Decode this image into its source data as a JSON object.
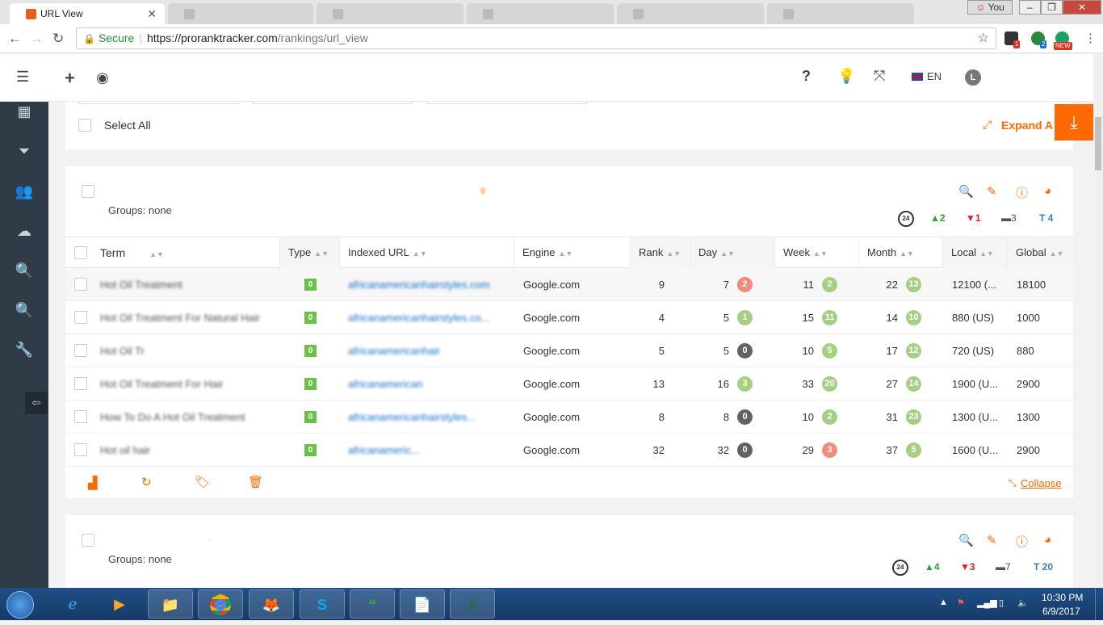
{
  "browser": {
    "tabs": [
      {
        "title": "URL View",
        "active": true
      },
      {
        "title": "",
        "active": false
      },
      {
        "title": "",
        "active": false
      },
      {
        "title": "",
        "active": false
      },
      {
        "title": "",
        "active": false
      },
      {
        "title": "",
        "active": false
      }
    ],
    "tab_close": "✕",
    "profile": "You",
    "secure_label": "Secure",
    "url_host": "https://proranktracker.com",
    "url_path": "/rankings/url_view",
    "ext_badge_1": "1",
    "ext_badge_2": "2",
    "ext_badge_new": "NEW"
  },
  "header": {
    "lang": "EN",
    "avatar": "L"
  },
  "topbar": {
    "select_all": "Select All",
    "expand": "Expand A"
  },
  "group1": {
    "groups": "Groups: none",
    "up": "2",
    "down": "1",
    "same": "3",
    "total": "T 4",
    "collapse": "Collapse",
    "columns": [
      "Term",
      "Type",
      "Indexed URL",
      "Engine",
      "Rank",
      "Day",
      "Week",
      "Month",
      "Local",
      "Global"
    ],
    "rows": [
      {
        "term": "Hot Oil Treatment",
        "type": "0",
        "url": "africanamericanhairstyles.com",
        "engine": "Google.com",
        "rank": "9",
        "day": "7",
        "day_badge": "2",
        "day_color": "red",
        "week": "11",
        "week_badge": "2",
        "week_color": "green",
        "month": "22",
        "month_badge": "13",
        "month_color": "green",
        "local": "12100 (...",
        "global": "18100"
      },
      {
        "term": "Hot Oil Treatment For Natural Hair",
        "type": "0",
        "url": "africanamericanhairstyles.co...",
        "engine": "Google.com",
        "rank": "4",
        "day": "5",
        "day_badge": "1",
        "day_color": "green",
        "week": "15",
        "week_badge": "11",
        "week_color": "green",
        "month": "14",
        "month_badge": "10",
        "month_color": "green",
        "local": "880 (US)",
        "global": "1000"
      },
      {
        "term": "Hot Oil Tr",
        "type": "0",
        "url": "africanamericanhair",
        "engine": "Google.com",
        "rank": "5",
        "day": "5",
        "day_badge": "0",
        "day_color": "dark",
        "week": "10",
        "week_badge": "5",
        "week_color": "green",
        "month": "17",
        "month_badge": "12",
        "month_color": "green",
        "local": "720 (US)",
        "global": "880"
      },
      {
        "term": "Hot Oil Treatment For Hair",
        "type": "0",
        "url": "africanamerican",
        "engine": "Google.com",
        "rank": "13",
        "day": "16",
        "day_badge": "3",
        "day_color": "green",
        "week": "33",
        "week_badge": "20",
        "week_color": "green",
        "month": "27",
        "month_badge": "14",
        "month_color": "green",
        "local": "1900 (U...",
        "global": "2900"
      },
      {
        "term": "How To Do A Hot Oil Treatment",
        "type": "0",
        "url": "africanamericanhairstyles...",
        "engine": "Google.com",
        "rank": "8",
        "day": "8",
        "day_badge": "0",
        "day_color": "dark",
        "week": "10",
        "week_badge": "2",
        "week_color": "green",
        "month": "31",
        "month_badge": "23",
        "month_color": "green",
        "local": "1300 (U...",
        "global": "1300"
      },
      {
        "term": "Hot oil hair",
        "type": "0",
        "url": "africanameric...",
        "engine": "Google.com",
        "rank": "32",
        "day": "32",
        "day_badge": "0",
        "day_color": "dark",
        "week": "29",
        "week_badge": "3",
        "week_color": "red",
        "month": "37",
        "month_badge": "5",
        "month_color": "green",
        "local": "1600 (U...",
        "global": "2900"
      }
    ]
  },
  "group2": {
    "groups": "Groups: none",
    "up": "4",
    "down": "3",
    "same": "7",
    "total": "T 20"
  },
  "taskbar": {
    "time": "10:30 PM",
    "date": "6/9/2017"
  },
  "colors": {
    "accent": "#ff6a00",
    "sidebar": "#2f3b46",
    "up": "#2e9e2e",
    "down": "#e02020",
    "badge_green": "#a7cf82",
    "badge_red": "#f08c7b",
    "badge_dark": "#5f6368"
  }
}
